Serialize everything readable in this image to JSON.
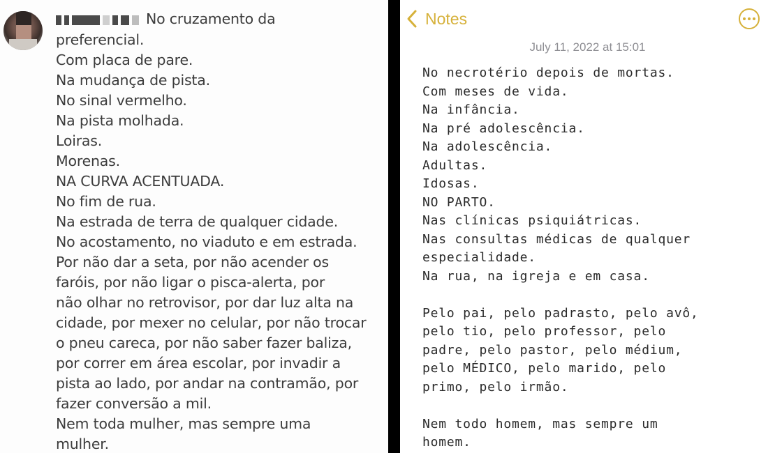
{
  "left_post": {
    "avatar_icon": "blurred-profile-photo",
    "username": "[redacted]",
    "lines": [
      "No cruzamento da",
      "preferencial.",
      "Com placa de pare.",
      "Na mudança de pista.",
      "No sinal vermelho.",
      "Na pista molhada.",
      "Loiras.",
      "Morenas.",
      "NA CURVA ACENTUADA.",
      "No fim de rua.",
      "Na estrada de terra de qualquer cidade.",
      "No acostamento, no viaduto e em estrada.",
      "Por não dar a seta, por não acender os",
      "faróis, por não ligar o pisca-alerta, por",
      "não olhar no retrovisor, por dar luz alta na",
      "cidade, por mexer no celular, por não trocar",
      "o pneu careca, por não saber fazer baliza,",
      "por correr em área escolar, por invadir a",
      "pista ao lado, por andar na contramão, por",
      "fazer conversão a mil.",
      "Nem toda mulher, mas sempre uma",
      "mulher."
    ]
  },
  "notes": {
    "back_label": "Notes",
    "back_icon": "chevron-left-icon",
    "more_icon": "ellipsis-circle-icon",
    "date": "July 11, 2022 at 15:01",
    "accent_color": "#d6b13a",
    "lines": [
      "No necrotério depois de mortas.",
      "Com meses de vida.",
      "Na infância.",
      "Na pré adolescência.",
      "Na adolescência.",
      "Adultas.",
      "Idosas.",
      "NO PARTO.",
      "Nas clínicas psiquiátricas.",
      "Nas consultas médicas de qualquer",
      "especialidade.",
      "Na rua, na igreja e em casa.",
      "",
      "Pelo pai, pelo padrasto, pelo avô,",
      "pelo tio, pelo professor, pelo",
      "padre, pelo pastor, pelo médium,",
      "pelo MÉDICO, pelo marido, pelo",
      "primo, pelo irmão.",
      "",
      "Nem todo homem, mas sempre um",
      "homem."
    ]
  }
}
